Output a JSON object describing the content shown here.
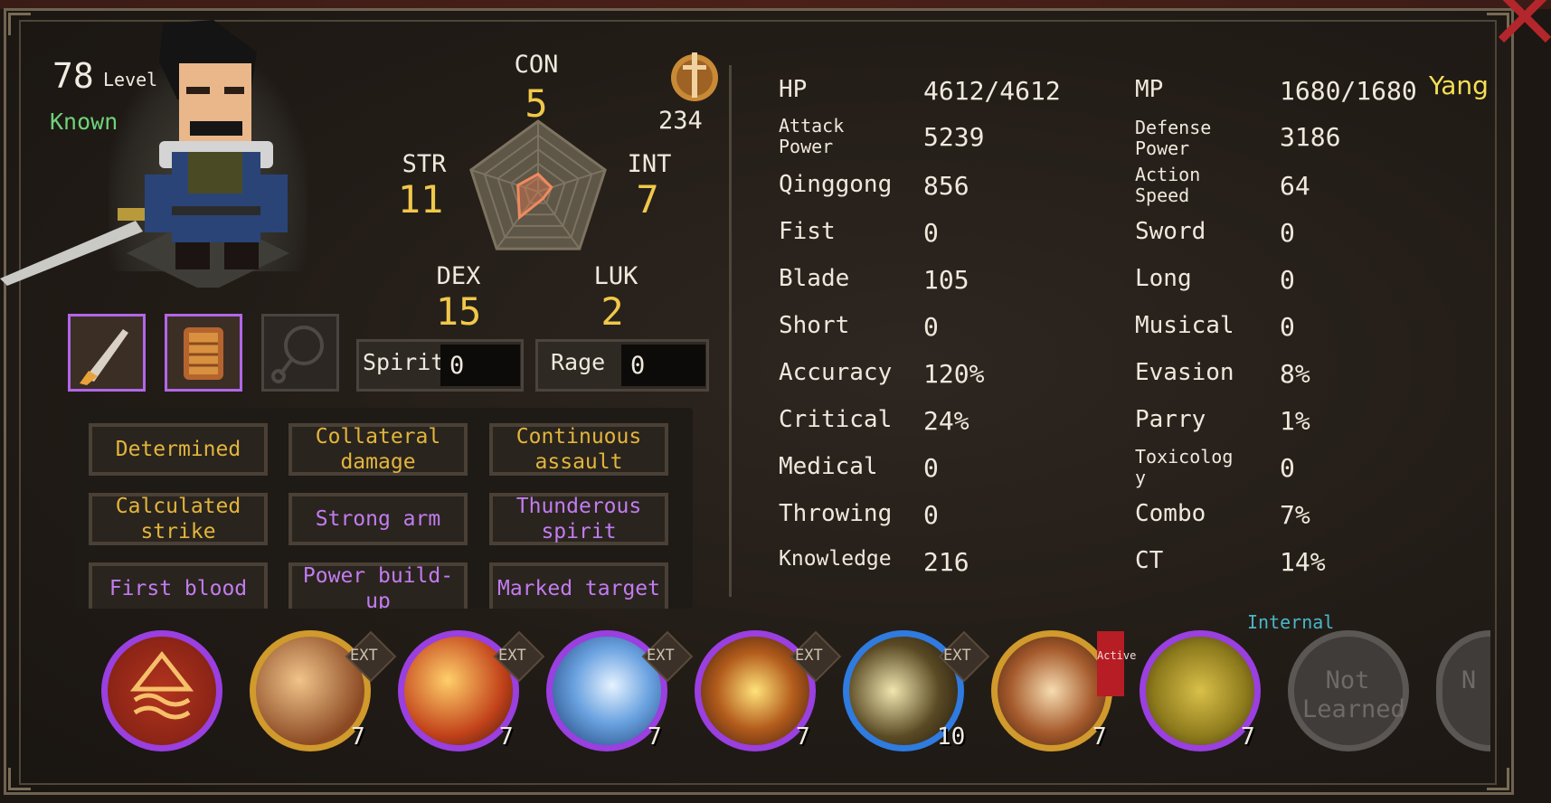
{
  "character": {
    "level": "78",
    "level_label": "Level",
    "status": "Known",
    "name": "Yang",
    "coin": "234"
  },
  "attributes": {
    "con_label": "CON",
    "con": "5",
    "str_label": "STR",
    "str": "11",
    "int_label": "INT",
    "int": "7",
    "dex_label": "DEX",
    "dex": "15",
    "luk_label": "LUK",
    "luk": "2",
    "radar_fraction": {
      "con": 0.25,
      "int": 0.2,
      "luk": 0.12,
      "dex": 0.45,
      "str": 0.3
    }
  },
  "equipment": [
    {
      "name": "blade-weapon",
      "state": "equipped"
    },
    {
      "name": "lamellar-armor",
      "state": "equipped"
    },
    {
      "name": "accessory-slot",
      "state": "empty"
    }
  ],
  "meters": {
    "spirit_label": "Spirit",
    "spirit": "0",
    "rage_label": "Rage",
    "rage": "0"
  },
  "traits": [
    {
      "label": "Determined",
      "color": "gold"
    },
    {
      "label": "Collateral damage",
      "color": "gold"
    },
    {
      "label": "Continuous assault",
      "color": "gold"
    },
    {
      "label": "Calculated strike",
      "color": "gold"
    },
    {
      "label": "Strong arm",
      "color": "purple"
    },
    {
      "label": "Thunderous spirit",
      "color": "purple"
    },
    {
      "label": "First blood",
      "color": "purple"
    },
    {
      "label": "Power build-up",
      "color": "purple"
    },
    {
      "label": "Marked target",
      "color": "purple"
    }
  ],
  "stats_left": [
    {
      "label": "HP",
      "value": "4612/4612"
    },
    {
      "label": "Attack Power",
      "value": "5239"
    },
    {
      "label": "Qinggong",
      "value": "856"
    },
    {
      "label": "Fist",
      "value": "0"
    },
    {
      "label": "Blade",
      "value": "105"
    },
    {
      "label": "Short",
      "value": "0"
    },
    {
      "label": "Accuracy",
      "value": "120%"
    },
    {
      "label": "Critical",
      "value": "24%"
    },
    {
      "label": "Medical",
      "value": "0"
    },
    {
      "label": "Throwing",
      "value": "0"
    },
    {
      "label": "Knowledge",
      "value": "216"
    }
  ],
  "stats_right": [
    {
      "label": "MP",
      "value": "1680/1680"
    },
    {
      "label": "Defense Power",
      "value": "3186"
    },
    {
      "label": "Action Speed",
      "value": "64"
    },
    {
      "label": "Sword",
      "value": "0"
    },
    {
      "label": "Long",
      "value": "0"
    },
    {
      "label": "Musical",
      "value": "0"
    },
    {
      "label": "Evasion",
      "value": "8%"
    },
    {
      "label": "Parry",
      "value": "1%"
    },
    {
      "label": "Toxicology",
      "value": "0"
    },
    {
      "label": "Combo",
      "value": "7%"
    },
    {
      "label": "CT",
      "value": "14%"
    }
  ],
  "skills": [
    {
      "name": "internal-art-skill",
      "ring": "purple",
      "tag": "",
      "count": ""
    },
    {
      "name": "blade-slash-skill",
      "ring": "gold",
      "tag": "EXT",
      "count": "7"
    },
    {
      "name": "flame-blade-skill",
      "ring": "purple",
      "tag": "EXT",
      "count": "7"
    },
    {
      "name": "frost-wave-skill",
      "ring": "purple",
      "tag": "EXT",
      "count": "7"
    },
    {
      "name": "sun-burst-skill",
      "ring": "purple",
      "tag": "EXT",
      "count": "7"
    },
    {
      "name": "crescent-moon-skill",
      "ring": "blue",
      "tag": "EXT",
      "count": "10"
    },
    {
      "name": "spike-wall-skill",
      "ring": "gold",
      "tag": "Active",
      "count": "7"
    },
    {
      "name": "golden-aura-skill",
      "ring": "purple",
      "tag": "Internal",
      "count": "7"
    },
    {
      "name": "empty-skill-slot",
      "ring": "grey",
      "tag": "Not Learned",
      "count": ""
    },
    {
      "name": "empty-skill-slot",
      "ring": "grey",
      "tag": "Not Learned",
      "count": ""
    }
  ],
  "labels": {
    "ext": "EXT",
    "active": "Active",
    "internal": "Internal",
    "not_learned": "Not Learned"
  },
  "colors": {
    "accent_gold": "#f0c84a",
    "accent_purple": "#b167e8",
    "known_green": "#6ed27a",
    "name_yellow": "#f5e055"
  }
}
